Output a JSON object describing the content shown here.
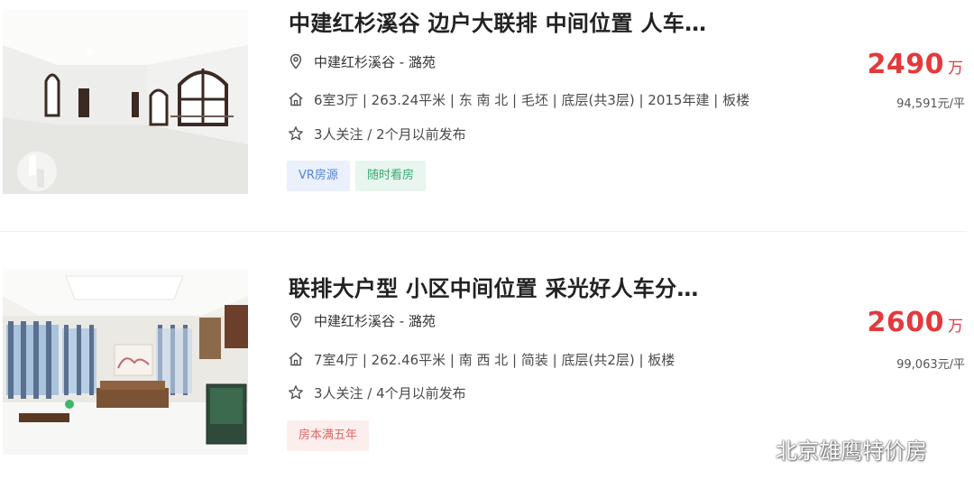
{
  "listings": [
    {
      "title": "中建红杉溪谷 边户大联排 中间位置 人车…",
      "location": "中建红杉溪谷 - 潞苑",
      "info": "6室3厅 | 263.24平米 | 东 南 北 | 毛坯 | 底层(共3层) | 2015年建 | 板楼",
      "follow": "3人关注 / 2个月以前发布",
      "tags": [
        "VR房源",
        "随时看房"
      ],
      "price": "2490",
      "price_unit": "万",
      "unit_price": "94,591元/平"
    },
    {
      "title": "联排大户型 小区中间位置 采光好人车分…",
      "location": "中建红杉溪谷 - 潞苑",
      "info": "7室4厅 | 262.46平米 | 南 西 北 | 简装 | 底层(共2层) | 板楼",
      "follow": "3人关注 / 4个月以前发布",
      "tags": [
        "房本满五年"
      ],
      "price": "2600",
      "price_unit": "万",
      "unit_price": "99,063元/平"
    }
  ],
  "watermark": "北京雄鹰特价房",
  "icons": {
    "location": "location-pin-icon",
    "info": "house-icon",
    "follow": "star-icon",
    "vr": "vr-3d-icon",
    "watermark": "wechat-icon"
  },
  "colors": {
    "price": "#e4393c",
    "vr_tag_bg": "#eaf0fc",
    "vr_tag_text": "#5584d8",
    "green_tag_bg": "#e8f6ef",
    "green_tag_text": "#3aa872",
    "red_tag_bg": "#fdeeee",
    "red_tag_text": "#e0665f"
  }
}
